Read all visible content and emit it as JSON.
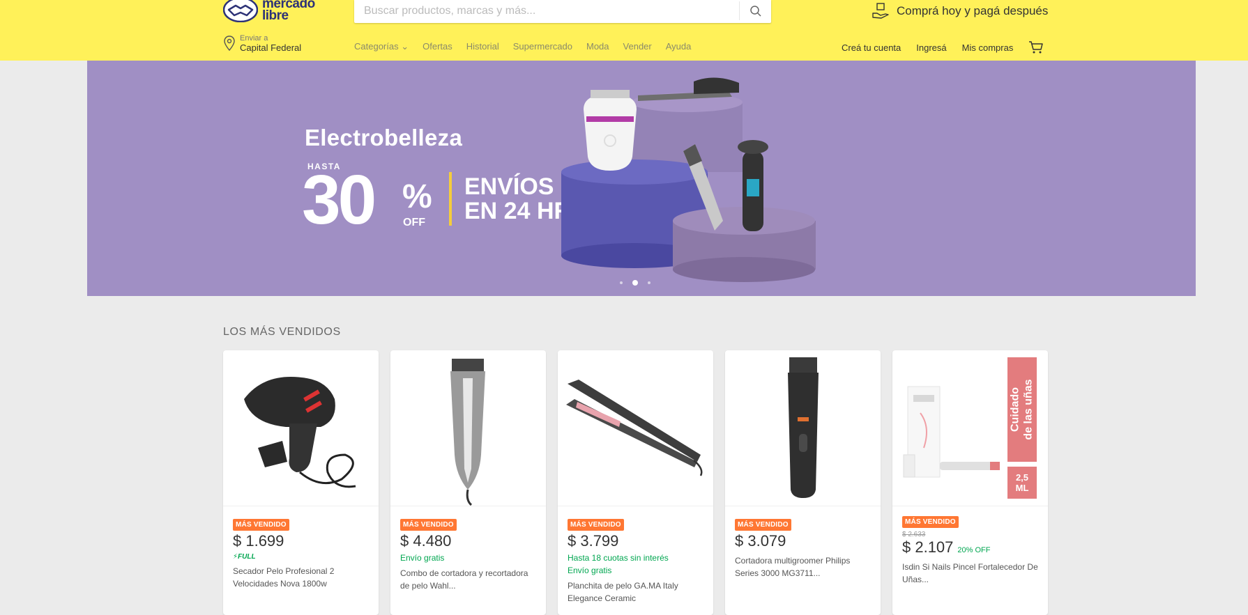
{
  "header": {
    "logo_text_line1": "mercado",
    "logo_text_line2": "libre",
    "search_placeholder": "Buscar productos, marcas y más...",
    "promo": "Comprá hoy y pagá después",
    "ship_label": "Enviar a",
    "ship_city": "Capital Federal",
    "nav": [
      "Categorías",
      "Ofertas",
      "Historial",
      "Supermercado",
      "Moda",
      "Vender",
      "Ayuda"
    ],
    "user_nav": {
      "create": "Creá tu cuenta",
      "login": "Ingresá",
      "purchases": "Mis compras"
    }
  },
  "hero": {
    "title": "Electrobelleza",
    "hasta": "HASTA",
    "number": "30",
    "percent": "%",
    "off": "OFF",
    "ship_line1": "ENVÍOS",
    "ship_line2": "EN 24 HRS",
    "colors": {
      "background": "#a08fc4",
      "accent": "#f5cd3c"
    }
  },
  "section": {
    "title": "LOS MÁS VENDIDOS"
  },
  "products": [
    {
      "badge": "MÁS VENDIDO",
      "price": "$ 1.699",
      "full": "⚡FULL",
      "desc": "Secador Pelo Profesional 2 Velocidades Nova 1800w"
    },
    {
      "badge": "MÁS VENDIDO",
      "price": "$ 4.480",
      "shipping": "Envío gratis",
      "desc": "Combo de cortadora y recortadora de pelo Wahl..."
    },
    {
      "badge": "MÁS VENDIDO",
      "price": "$ 3.799",
      "installments": "Hasta 18 cuotas sin interés",
      "shipping": "Envío gratis",
      "desc": "Planchita de pelo GA.MA Italy Elegance Ceramic"
    },
    {
      "badge": "MÁS VENDIDO",
      "price": "$ 3.079",
      "desc": "Cortadora multigroomer Philips Series 3000 MG3711..."
    },
    {
      "badge": "MÁS VENDIDO",
      "old_price": "$ 2.633",
      "price": "$ 2.107",
      "discount": "20% OFF",
      "desc": "Isdin Si Nails Pincel Fortalecedor De Uñas...",
      "tag_line1": "Cuidado",
      "tag_line2": "de las uñas",
      "tag_ml_line1": "2,5",
      "tag_ml_line2": "ML"
    }
  ]
}
